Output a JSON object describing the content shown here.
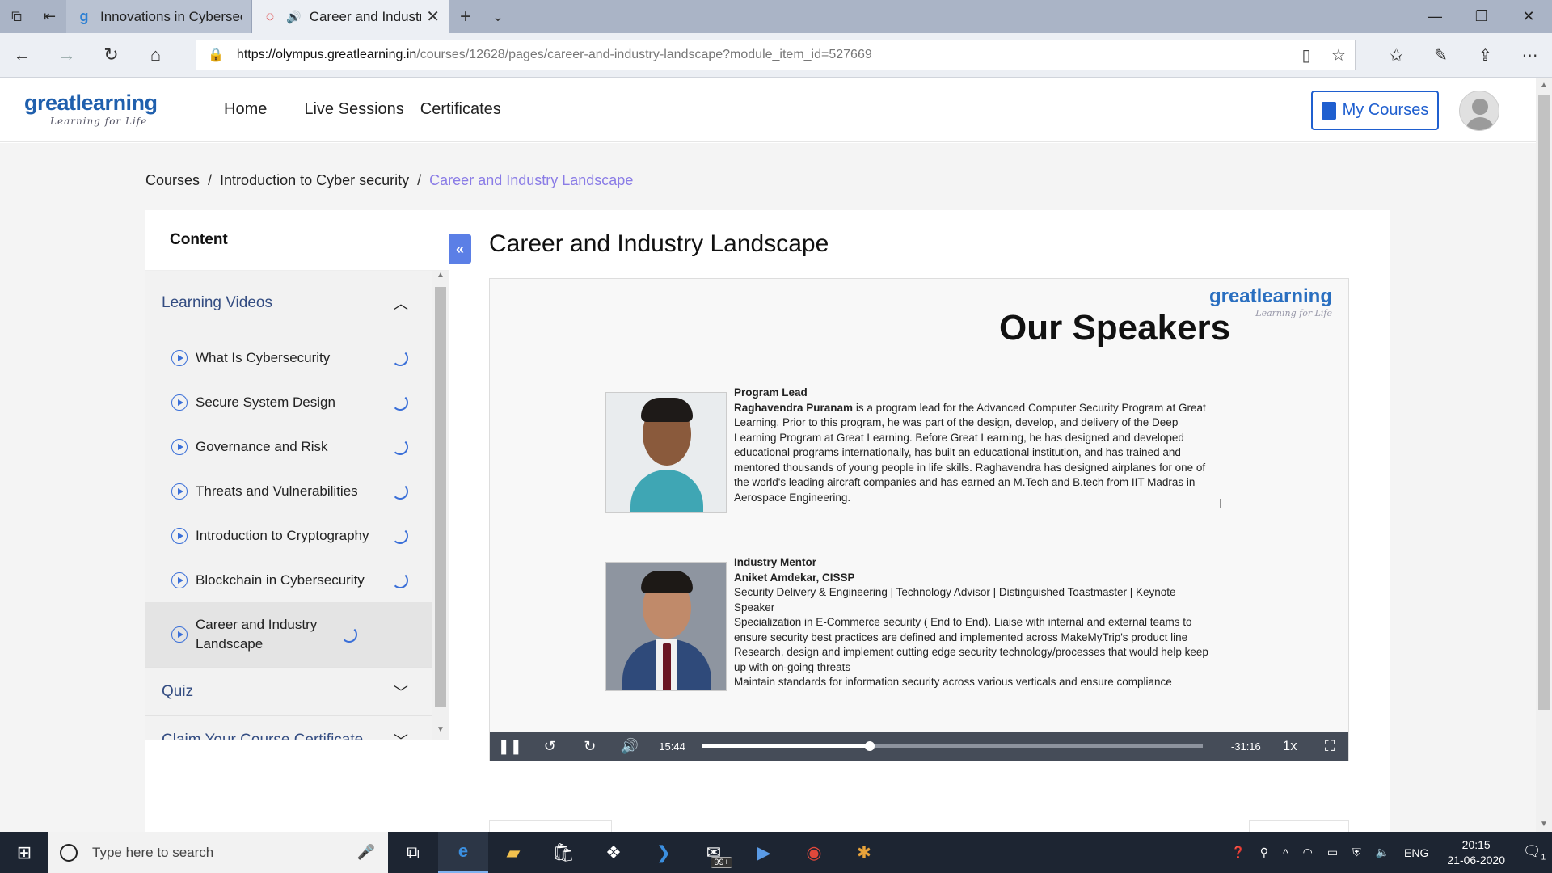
{
  "browser": {
    "tabs": [
      {
        "title": "Innovations in Cybersecurity",
        "active": false
      },
      {
        "title": "Career and Industry",
        "active": true
      }
    ],
    "url_host": "https://olympus.greatlearning.in",
    "url_path": "/courses/12628/pages/career-and-industry-landscape?module_item_id=527669"
  },
  "site": {
    "logo_main": "greatlearning",
    "logo_tagline": "Learning for Life",
    "nav": {
      "home": "Home",
      "live": "Live Sessions",
      "certs": "Certificates"
    },
    "my_courses": "My Courses"
  },
  "breadcrumb": {
    "courses": "Courses",
    "course": "Introduction to Cyber security",
    "current": "Career and Industry Landscape"
  },
  "sidebar": {
    "heading": "Content",
    "section1": "Learning Videos",
    "items": [
      {
        "label": "What Is Cybersecurity"
      },
      {
        "label": "Secure System Design"
      },
      {
        "label": "Governance and Risk"
      },
      {
        "label": "Threats and Vulnerabilities"
      },
      {
        "label": "Introduction to Cryptography"
      },
      {
        "label": "Blockchain in Cybersecurity"
      },
      {
        "label": "Career and Industry Landscape"
      }
    ],
    "section2": "Quiz",
    "section3": "Claim Your Course Certificate"
  },
  "main": {
    "title": "Career and Industry Landscape"
  },
  "video": {
    "logo_main": "greatlearning",
    "logo_tagline": "Learning for Life",
    "heading": "Our Speakers",
    "speaker1": {
      "role": "Program Lead",
      "name": "Raghavendra Puranam",
      "bio": " is a program lead for the Advanced Computer Security Program at Great Learning. Prior to this program, he was part of the design, develop, and delivery of the Deep Learning Program at Great Learning.  Before Great Learning, he has designed and developed educational programs internationally, has built an educational institution, and has trained and mentored thousands of young people in life skills. Raghavendra has designed airplanes for one of the world's leading aircraft companies and has earned an M.Tech and B.tech from IIT Madras in Aerospace Engineering."
    },
    "speaker2": {
      "role": "Industry Mentor",
      "name": "Aniket Amdekar, CISSP",
      "line1": "Security Delivery & Engineering | Technology Advisor | Distinguished Toastmaster | Keynote Speaker",
      "line2": "Specialization in E-Commerce security ( End to End). Liaise with internal and external teams to ensure security best practices are defined and implemented across MakeMyTrip's product line",
      "line3": "Research, design and implement cutting edge security technology/processes that would help keep up with on-going threats",
      "line4": "Maintain standards for information security across various verticals and ensure compliance"
    },
    "elapsed": "15:44",
    "remaining": "-31:16",
    "rate": "1x",
    "progress_fraction": 0.335
  },
  "taskbar": {
    "search_placeholder": "Type here to search",
    "mail_badge": "99+",
    "lang": "ENG",
    "time": "20:15",
    "date": "21-06-2020",
    "notif_count": "1"
  }
}
